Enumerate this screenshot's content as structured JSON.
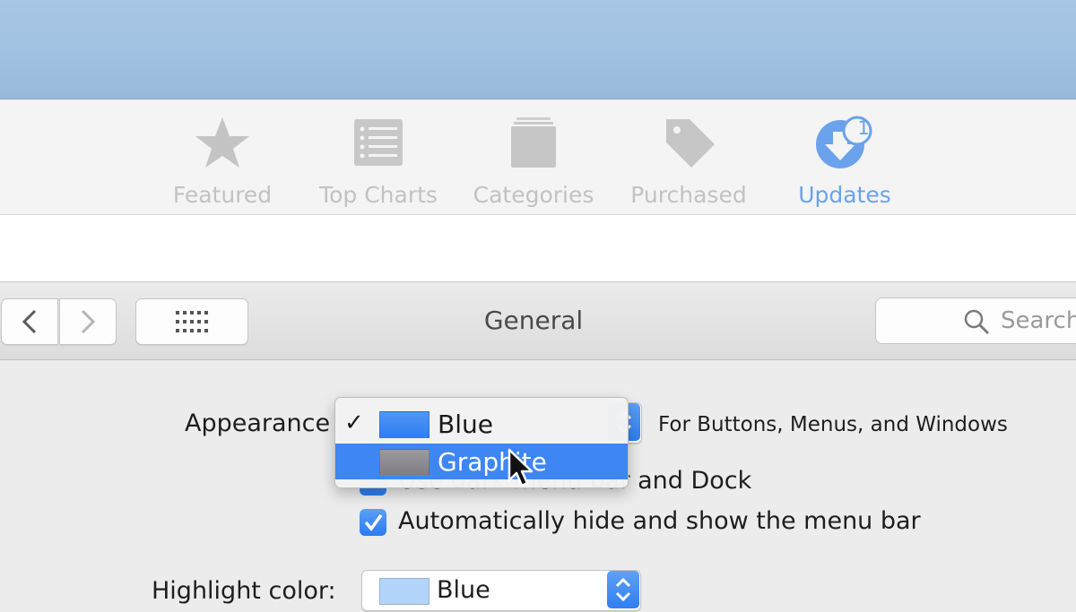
{
  "appstore": {
    "tabs": [
      {
        "label": "Featured",
        "icon": "star-icon"
      },
      {
        "label": "Top Charts",
        "icon": "list-icon"
      },
      {
        "label": "Categories",
        "icon": "stack-icon"
      },
      {
        "label": "Purchased",
        "icon": "tag-icon"
      },
      {
        "label": "Updates",
        "icon": "download-icon",
        "badge": "1",
        "active": true
      }
    ]
  },
  "prefs": {
    "title": "General",
    "search_placeholder": "Search"
  },
  "general": {
    "appearance_label": "Appearance",
    "appearance_note": "For Buttons, Menus, and Windows",
    "appearance_menu": {
      "items": [
        {
          "label": "Blue",
          "checked": true,
          "swatch": "#2f7ef2"
        },
        {
          "label": "Graphite",
          "checked": false,
          "swatch": "#8e8e93",
          "highlighted": true
        }
      ]
    },
    "dark_menu_checkbox": "Use dark menu bar and Dock",
    "autohide_checkbox": "Automatically hide and show the menu bar",
    "highlight_label": "Highlight color:",
    "highlight_value": "Blue",
    "highlight_swatch": "#b3d4fb"
  },
  "colors": {
    "accent": "#3d86f3",
    "active_tab": "#6aa2ec",
    "inactive_tab": "#c2c2c2"
  }
}
